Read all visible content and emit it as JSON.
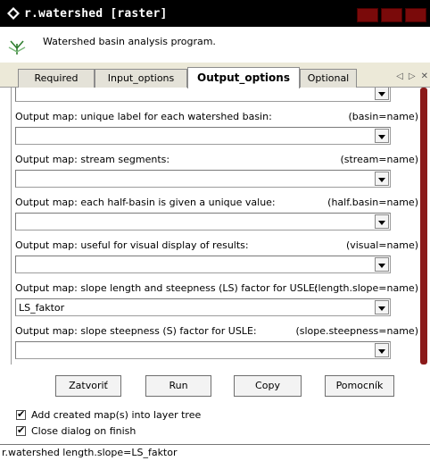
{
  "window": {
    "title": "r.watershed [raster]"
  },
  "header": {
    "description": "Watershed basin analysis program."
  },
  "tabs": [
    {
      "label": "Required"
    },
    {
      "label": "Input_options"
    },
    {
      "label": "Output_options",
      "active": true
    },
    {
      "label": "Optional"
    }
  ],
  "tabnav": {
    "prev": "◁",
    "next": "▷",
    "close": "✕"
  },
  "fields": [
    {
      "label": "Output map: unique label for each watershed basin:",
      "key": "(basin=name)",
      "value": ""
    },
    {
      "label": "Output map: stream segments:",
      "key": "(stream=name)",
      "value": ""
    },
    {
      "label": "Output map: each half-basin is given a unique value:",
      "key": "(half.basin=name)",
      "value": ""
    },
    {
      "label": "Output map: useful for visual display of results:",
      "key": "(visual=name)",
      "value": ""
    },
    {
      "label": "Output map: slope length and steepness (LS) factor for USLE:",
      "key": "(length.slope=name)",
      "value": "LS_faktor"
    },
    {
      "label": "Output map: slope steepness (S) factor for USLE:",
      "key": "(slope.steepness=name)",
      "value": ""
    }
  ],
  "buttons": {
    "close": "Zatvoriť",
    "run": "Run",
    "copy": "Copy",
    "help": "Pomocník"
  },
  "options": {
    "add_to_tree": {
      "label": "Add created map(s) into layer tree",
      "checked": true
    },
    "close_on_finish": {
      "label": "Close dialog on finish",
      "checked": true
    }
  },
  "status": {
    "command": "r.watershed length.slope=LS_faktor"
  }
}
